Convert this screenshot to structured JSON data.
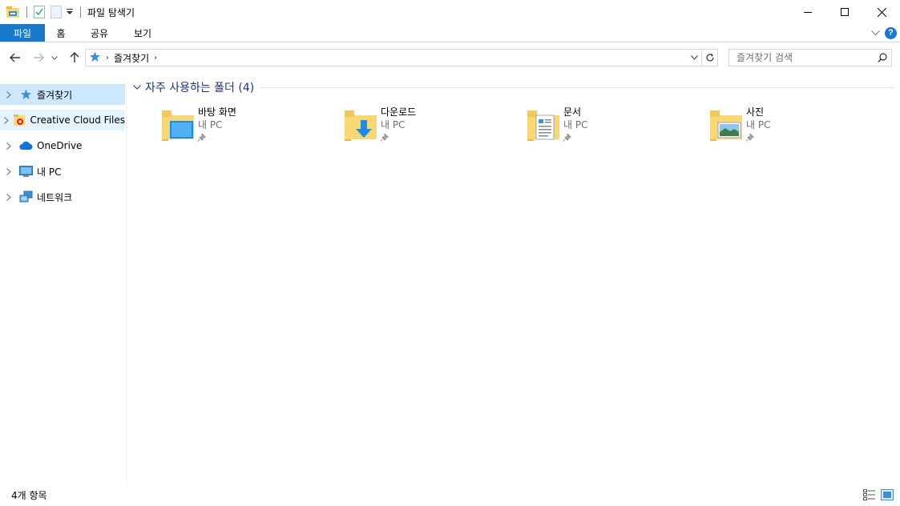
{
  "window": {
    "title": "파일 탐색기"
  },
  "ribbon": {
    "tabs": [
      {
        "label": "파일"
      },
      {
        "label": "홈"
      },
      {
        "label": "공유"
      },
      {
        "label": "보기"
      }
    ]
  },
  "address": {
    "path": [
      "즐겨찾기"
    ]
  },
  "search": {
    "placeholder": "즐겨찾기 검색"
  },
  "sidebar": {
    "items": [
      {
        "label": "즐겨찾기",
        "icon": "star-icon",
        "selected": true
      },
      {
        "label": "Creative Cloud Files",
        "icon": "creative-cloud-folder-icon"
      },
      {
        "label": "OneDrive",
        "icon": "onedrive-cloud-icon"
      },
      {
        "label": "내 PC",
        "icon": "pc-monitor-icon"
      },
      {
        "label": "네트워크",
        "icon": "network-icon"
      }
    ]
  },
  "main": {
    "section_title": "자주 사용하는 폴더 (4)",
    "folders": [
      {
        "name": "바탕 화면",
        "location": "내 PC",
        "icon": "desktop-folder-icon"
      },
      {
        "name": "다운로드",
        "location": "내 PC",
        "icon": "downloads-folder-icon"
      },
      {
        "name": "문서",
        "location": "내 PC",
        "icon": "documents-folder-icon"
      },
      {
        "name": "사진",
        "location": "내 PC",
        "icon": "pictures-folder-icon"
      }
    ]
  },
  "status": {
    "item_count": "4개 항목"
  },
  "colors": {
    "accent": "#1979ca",
    "selection": "#cce8ff",
    "section_title": "#1e3287",
    "folder": "#f8d775"
  }
}
